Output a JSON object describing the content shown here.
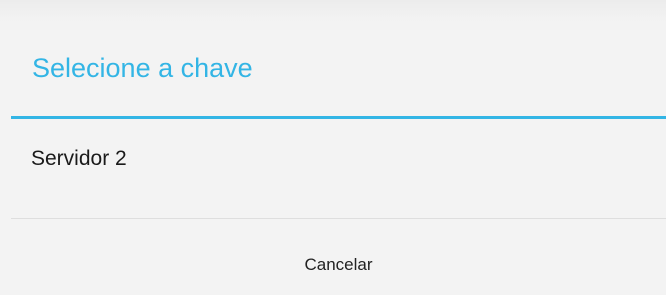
{
  "dialog": {
    "title": "Selecione a chave",
    "items": [
      {
        "label": "Servidor 2"
      }
    ],
    "buttons": {
      "cancel_label": "Cancelar"
    }
  },
  "colors": {
    "accent": "#33b5e5",
    "background": "#f3f3f3",
    "text": "#1a1a1a"
  }
}
